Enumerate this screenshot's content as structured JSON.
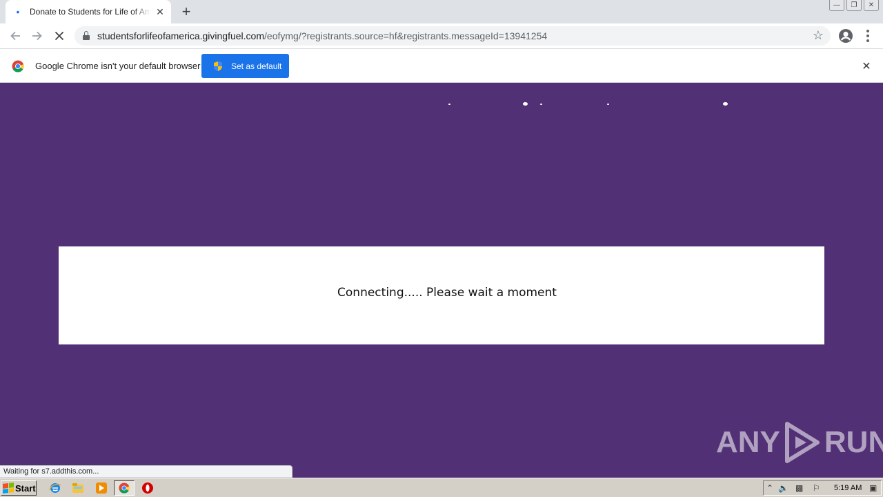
{
  "browser": {
    "tab_title": "Donate to Students for Life of America",
    "new_tab_label": "+",
    "url_host": "studentsforlifeofamerica.givingfuel.com",
    "url_path": "/eofymg/?registrants.source=hf&registrants.messageId=13941254",
    "accent_color": "#1a73e8"
  },
  "infobar": {
    "message": "Google Chrome isn't your default browser",
    "set_default_label": "Set as default"
  },
  "page": {
    "background_color": "#523076",
    "modal_message": "Connecting..... Please wait a moment",
    "status_text": "Waiting for s7.addthis.com...",
    "watermark_left": "ANY",
    "watermark_right": "RUN"
  },
  "taskbar": {
    "start_label": "Start",
    "clock": "5:19 AM"
  },
  "icons": [
    "favicon-icon",
    "close-icon",
    "back-icon",
    "forward-icon",
    "stop-icon",
    "lock-icon",
    "star-icon",
    "profile-icon",
    "menu-icon",
    "chrome-logo-icon",
    "shield-icon",
    "windows-logo-icon",
    "ie-icon",
    "explorer-icon",
    "media-player-icon",
    "chrome-icon",
    "opera-icon"
  ]
}
